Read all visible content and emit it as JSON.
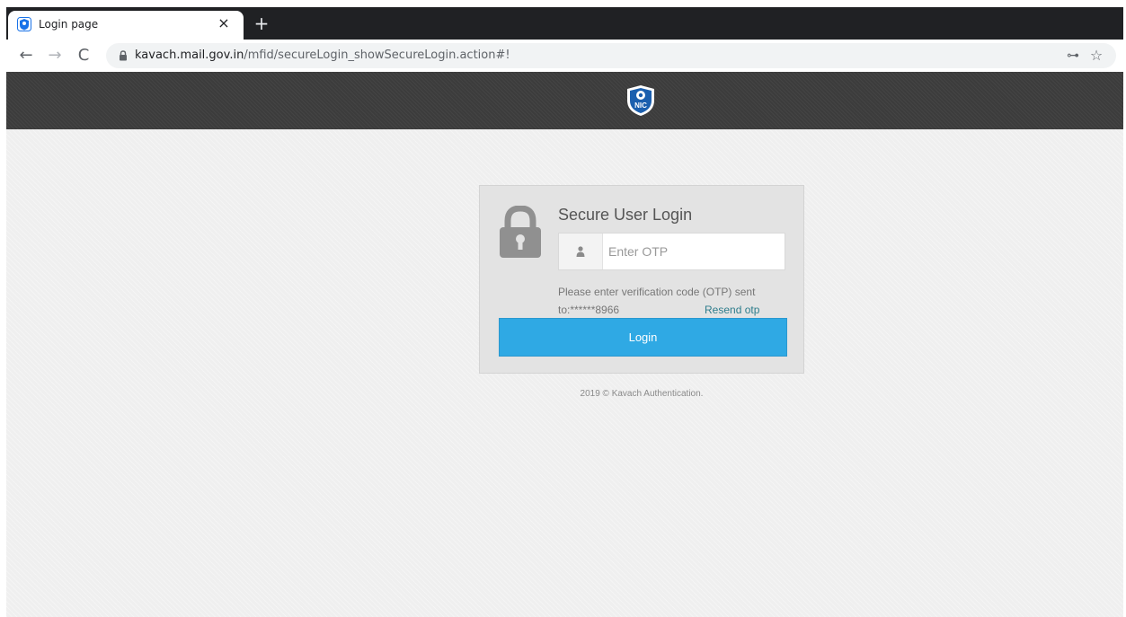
{
  "browser": {
    "tab_title": "Login page",
    "tab_close": "×",
    "new_tab": "+",
    "back": "←",
    "forward": "→",
    "reload": "C",
    "url_host": "kavach.mail.gov.in",
    "url_path": "/mfid/secureLogin_showSecureLogin.action#!",
    "key_icon": "key-icon",
    "star_icon": "star-icon"
  },
  "header": {
    "logo_text": "NIC"
  },
  "login": {
    "title": "Secure User Login",
    "otp_placeholder": "Enter OTP",
    "otp_value": "",
    "help_line1": "Please enter verification code (OTP) sent",
    "help_line2": "to:******8966",
    "resend_label": "Resend otp",
    "login_label": "Login"
  },
  "footer": {
    "text": "2019 © Kavach Authentication."
  },
  "colors": {
    "header_bg": "#3c3c3c",
    "button_bg": "#2fa9e4",
    "resend_link": "#2e7d8c",
    "page_bg": "#efefef"
  }
}
